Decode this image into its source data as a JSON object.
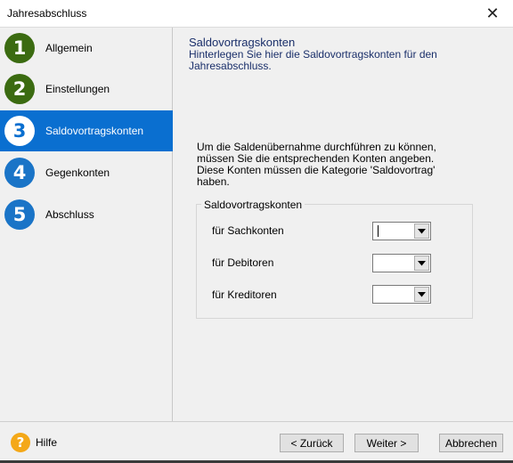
{
  "window": {
    "title": "Jahresabschluss",
    "close_symbol": "✕"
  },
  "steps": [
    {
      "number": "1",
      "label": "Allgemein",
      "state": "done"
    },
    {
      "number": "2",
      "label": "Einstellungen",
      "state": "done"
    },
    {
      "number": "3",
      "label": "Saldovortragskonten",
      "state": "active"
    },
    {
      "number": "4",
      "label": "Gegenkonten",
      "state": "todo"
    },
    {
      "number": "5",
      "label": "Abschluss",
      "state": "todo"
    }
  ],
  "header": {
    "title": "Saldovortragskonten",
    "subtitle": "Hinterlegen Sie hier die Saldovortragskonten für den Jahresabschluss."
  },
  "description": "Um die Saldenübernahme durchführen zu können, müssen Sie die entsprechenden Konten angeben. Diese Konten müssen die Kategorie 'Saldovortrag' haben.",
  "group": {
    "legend": "Saldovortragskonten",
    "rows": [
      {
        "label": "für Sachkonten",
        "value": ""
      },
      {
        "label": "für Debitoren",
        "value": ""
      },
      {
        "label": "für Kreditoren",
        "value": ""
      }
    ]
  },
  "footer": {
    "help_icon": "?",
    "help_label": "Hilfe",
    "back_label": "< Zurück",
    "next_label": "Weiter >",
    "cancel_label": "Abbrechen"
  },
  "colors": {
    "step_done": "#3b6b11",
    "step_todo": "#1a74c7",
    "step_active_bg": "#0a6fd0",
    "header_text": "#1a2f6a",
    "help_icon": "#f4a818"
  }
}
